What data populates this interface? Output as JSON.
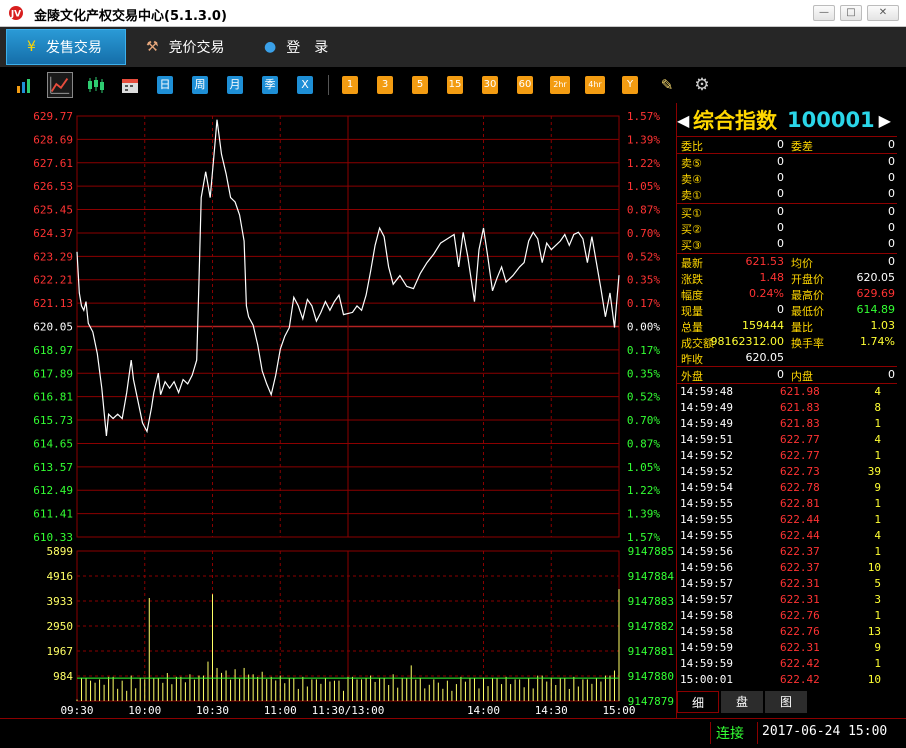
{
  "window": {
    "title": "金陵文化产权交易中心(5.1.3.0)",
    "min_glyph": "—",
    "max_glyph": "□",
    "close_glyph": "✕"
  },
  "tabs": [
    {
      "label": "发售交易",
      "icon": "yen-icon",
      "glyph": "¥",
      "active": true
    },
    {
      "label": "竞价交易",
      "icon": "gavel-icon",
      "glyph": "⚒",
      "active": false
    },
    {
      "label": "登　录",
      "icon": "user-icon",
      "glyph": "●",
      "active": false
    }
  ],
  "toolbar": {
    "view_icons": [
      {
        "name": "bar-chart-icon",
        "glyph": "▮"
      },
      {
        "name": "line-chart-icon",
        "glyph": "⟋"
      },
      {
        "name": "candlestick-icon",
        "glyph": "┃"
      },
      {
        "name": "calendar-icon",
        "glyph": "▦"
      }
    ],
    "period_buttons": [
      "日",
      "周",
      "月",
      "季",
      "X"
    ],
    "minute_buttons": [
      "1",
      "3",
      "5",
      "15",
      "30",
      "60",
      "2hr",
      "4hr",
      "Y"
    ],
    "tool_icons": [
      {
        "name": "draw-icon",
        "glyph": "✎"
      },
      {
        "name": "settings-gear-icon",
        "glyph": "⚙"
      }
    ]
  },
  "chart_data": {
    "type": "line",
    "title": "",
    "price_axis": [
      "629.77",
      "628.69",
      "627.61",
      "626.53",
      "625.45",
      "624.37",
      "623.29",
      "622.21",
      "621.13",
      "620.05",
      "618.97",
      "617.89",
      "616.81",
      "615.73",
      "614.65",
      "613.57",
      "612.49",
      "611.41",
      "610.33"
    ],
    "pct_axis": [
      "1.57%",
      "1.39%",
      "1.22%",
      "1.05%",
      "0.87%",
      "0.70%",
      "0.52%",
      "0.35%",
      "0.17%",
      "0.00%",
      "0.17%",
      "0.35%",
      "0.52%",
      "0.70%",
      "0.87%",
      "1.05%",
      "1.22%",
      "1.39%",
      "1.57%"
    ],
    "price_ylim": [
      610.33,
      629.77
    ],
    "prev_close": 620.05,
    "volume_axis": [
      "5899",
      "4916",
      "3933",
      "2950",
      "1967",
      "984"
    ],
    "amount_axis": [
      "9147885",
      "9147884",
      "9147883",
      "9147882",
      "9147881",
      "9147880",
      "9147879"
    ],
    "volume_ylim": [
      0,
      5899
    ],
    "time_labels": [
      "09:30",
      "10:00",
      "10:30",
      "11:00",
      "11:30/13:00",
      "14:00",
      "14:30",
      "15:00"
    ],
    "x_range": [
      "09:30",
      "15:00"
    ],
    "price_series": [
      [
        "09:30",
        623.5
      ],
      [
        "09:31",
        621.6
      ],
      [
        "09:32",
        621.0
      ],
      [
        "09:33",
        620.8
      ],
      [
        "09:34",
        621.2
      ],
      [
        "09:35",
        620.2
      ],
      [
        "09:37",
        619.8
      ],
      [
        "09:39",
        618.8
      ],
      [
        "09:41",
        617.2
      ],
      [
        "09:43",
        615.0
      ],
      [
        "09:44",
        616.0
      ],
      [
        "09:46",
        615.8
      ],
      [
        "09:48",
        616.0
      ],
      [
        "09:50",
        615.8
      ],
      [
        "09:52",
        617.0
      ],
      [
        "09:54",
        618.5
      ],
      [
        "09:55",
        617.6
      ],
      [
        "09:57",
        616.6
      ],
      [
        "09:59",
        615.6
      ],
      [
        "10:01",
        615.2
      ],
      [
        "10:03",
        616.3
      ],
      [
        "10:04",
        617.0
      ],
      [
        "10:06",
        617.9
      ],
      [
        "10:07",
        616.9
      ],
      [
        "10:09",
        617.5
      ],
      [
        "10:11",
        617.2
      ],
      [
        "10:13",
        617.5
      ],
      [
        "10:15",
        617.0
      ],
      [
        "10:17",
        617.6
      ],
      [
        "10:19",
        617.4
      ],
      [
        "10:21",
        617.8
      ],
      [
        "10:23",
        618.5
      ],
      [
        "10:24",
        622.0
      ],
      [
        "10:25",
        626.0
      ],
      [
        "10:27",
        627.2
      ],
      [
        "10:29",
        626.0
      ],
      [
        "10:31",
        628.4
      ],
      [
        "10:32",
        629.6
      ],
      [
        "10:34",
        628.0
      ],
      [
        "10:36",
        627.1
      ],
      [
        "10:38",
        626.0
      ],
      [
        "10:40",
        625.8
      ],
      [
        "10:42",
        625.2
      ],
      [
        "10:44",
        624.0
      ],
      [
        "10:45",
        621.0
      ],
      [
        "10:46",
        620.5
      ],
      [
        "10:48",
        620.1
      ],
      [
        "10:50",
        619.2
      ],
      [
        "10:52",
        618.0
      ],
      [
        "10:54",
        617.4
      ],
      [
        "10:56",
        616.9
      ],
      [
        "10:58",
        617.8
      ],
      [
        "11:00",
        619.0
      ],
      [
        "11:02",
        619.6
      ],
      [
        "11:04",
        620.0
      ],
      [
        "11:06",
        621.4
      ],
      [
        "11:08",
        621.0
      ],
      [
        "11:10",
        620.4
      ],
      [
        "11:12",
        621.3
      ],
      [
        "11:14",
        621.0
      ],
      [
        "11:16",
        620.3
      ],
      [
        "11:18",
        620.7
      ],
      [
        "11:20",
        621.2
      ],
      [
        "11:22",
        620.8
      ],
      [
        "11:24",
        621.2
      ],
      [
        "11:26",
        621.5
      ],
      [
        "11:28",
        620.6
      ],
      [
        "13:02",
        620.7
      ],
      [
        "13:04",
        621.0
      ],
      [
        "13:06",
        620.8
      ],
      [
        "13:08",
        621.5
      ],
      [
        "13:10",
        622.6
      ],
      [
        "13:12",
        623.8
      ],
      [
        "13:14",
        624.6
      ],
      [
        "13:16",
        624.2
      ],
      [
        "13:18",
        622.8
      ],
      [
        "13:20",
        622.0
      ],
      [
        "13:23",
        622.4
      ],
      [
        "13:26",
        621.9
      ],
      [
        "13:29",
        621.8
      ],
      [
        "13:32",
        622.5
      ],
      [
        "13:35",
        623.0
      ],
      [
        "13:38",
        623.4
      ],
      [
        "13:41",
        623.9
      ],
      [
        "13:44",
        624.1
      ],
      [
        "13:47",
        624.3
      ],
      [
        "13:49",
        622.8
      ],
      [
        "13:51",
        624.4
      ],
      [
        "13:53",
        623.3
      ],
      [
        "13:56",
        621.2
      ],
      [
        "13:58",
        623.6
      ],
      [
        "14:00",
        624.6
      ],
      [
        "14:02",
        623.2
      ],
      [
        "14:04",
        621.7
      ],
      [
        "14:06",
        622.3
      ],
      [
        "14:08",
        622.8
      ],
      [
        "14:10",
        622.1
      ],
      [
        "14:13",
        622.4
      ],
      [
        "14:16",
        622.8
      ],
      [
        "14:18",
        623.0
      ],
      [
        "14:20",
        624.0
      ],
      [
        "14:22",
        624.4
      ],
      [
        "14:24",
        624.1
      ],
      [
        "14:26",
        623.0
      ],
      [
        "14:28",
        623.9
      ],
      [
        "14:30",
        623.6
      ],
      [
        "14:32",
        623.8
      ],
      [
        "14:34",
        624.0
      ],
      [
        "14:36",
        624.3
      ],
      [
        "14:38",
        623.8
      ],
      [
        "14:40",
        624.3
      ],
      [
        "14:42",
        624.4
      ],
      [
        "14:44",
        624.1
      ],
      [
        "14:46",
        623.0
      ],
      [
        "14:48",
        624.2
      ],
      [
        "14:50",
        623.0
      ],
      [
        "14:52",
        621.8
      ],
      [
        "14:54",
        620.5
      ],
      [
        "14:56",
        621.6
      ],
      [
        "14:58",
        620.0
      ],
      [
        "15:00",
        622.42
      ]
    ],
    "volume_series": [
      [
        "09:30",
        60
      ],
      [
        "09:33",
        900
      ],
      [
        "09:36",
        800
      ],
      [
        "09:40",
        850
      ],
      [
        "09:45",
        950
      ],
      [
        "09:50",
        800
      ],
      [
        "09:54",
        1000
      ],
      [
        "09:58",
        900
      ],
      [
        "10:01",
        850
      ],
      [
        "10:02",
        4050
      ],
      [
        "10:05",
        900
      ],
      [
        "10:10",
        1100
      ],
      [
        "10:15",
        950
      ],
      [
        "10:20",
        1050
      ],
      [
        "10:25",
        1000
      ],
      [
        "10:29",
        1550
      ],
      [
        "10:30",
        4200
      ],
      [
        "10:32",
        1300
      ],
      [
        "10:36",
        1200
      ],
      [
        "10:40",
        1250
      ],
      [
        "10:44",
        1300
      ],
      [
        "10:48",
        1050
      ],
      [
        "10:52",
        1150
      ],
      [
        "10:56",
        950
      ],
      [
        "11:00",
        1000
      ],
      [
        "11:05",
        900
      ],
      [
        "11:10",
        950
      ],
      [
        "11:15",
        850
      ],
      [
        "11:20",
        900
      ],
      [
        "11:25",
        800
      ],
      [
        "13:01",
        950
      ],
      [
        "13:05",
        850
      ],
      [
        "13:10",
        1000
      ],
      [
        "13:15",
        900
      ],
      [
        "13:20",
        1050
      ],
      [
        "13:25",
        900
      ],
      [
        "13:28",
        1400
      ],
      [
        "13:32",
        900
      ],
      [
        "13:38",
        850
      ],
      [
        "13:44",
        800
      ],
      [
        "13:50",
        950
      ],
      [
        "13:55",
        900
      ],
      [
        "14:00",
        900
      ],
      [
        "14:05",
        900
      ],
      [
        "14:10",
        950
      ],
      [
        "14:15",
        850
      ],
      [
        "14:20",
        900
      ],
      [
        "14:25",
        1000
      ],
      [
        "14:30",
        900
      ],
      [
        "14:35",
        900
      ],
      [
        "14:40",
        950
      ],
      [
        "14:45",
        850
      ],
      [
        "14:50",
        900
      ],
      [
        "14:55",
        1000
      ],
      [
        "14:58",
        1200
      ],
      [
        "14:59",
        5200
      ],
      [
        "15:00",
        4400
      ]
    ]
  },
  "quote_panel": {
    "name": "综合指数",
    "code": "100001",
    "arrow_left": "◀",
    "arrow_right": "▶",
    "weibi_label": "委比",
    "weibi_value": "0",
    "weicha_label": "委差",
    "weicha_value": "0",
    "asks": [
      {
        "label": "卖⑤",
        "price": "0",
        "qty": "0"
      },
      {
        "label": "卖④",
        "price": "0",
        "qty": "0"
      },
      {
        "label": "卖①",
        "price": "0",
        "qty": "0"
      }
    ],
    "bids": [
      {
        "label": "买①",
        "price": "0",
        "qty": "0"
      },
      {
        "label": "买②",
        "price": "0",
        "qty": "0"
      },
      {
        "label": "买③",
        "price": "0",
        "qty": "0"
      }
    ],
    "stats": [
      {
        "l1": "最新",
        "v1": "621.53",
        "c1": "r",
        "l2": "均价",
        "v2": "0",
        "c2": "w"
      },
      {
        "l1": "涨跌",
        "v1": "1.48",
        "c1": "r",
        "l2": "开盘价",
        "v2": "620.05",
        "c2": "w"
      },
      {
        "l1": "幅度",
        "v1": "0.24%",
        "c1": "r",
        "l2": "最高价",
        "v2": "629.69",
        "c2": "r"
      },
      {
        "l1": "现量",
        "v1": "0",
        "c1": "w",
        "l2": "最低价",
        "v2": "614.89",
        "c2": "g"
      },
      {
        "l1": "总量",
        "v1": "159444",
        "c1": "y",
        "l2": "量比",
        "v2": "1.03",
        "c2": "y"
      },
      {
        "l1": "成交额",
        "v1": "98162312.00",
        "c1": "y",
        "l2": "换手率",
        "v2": "1.74%",
        "c2": "y"
      },
      {
        "l1": "昨收",
        "v1": "620.05",
        "c1": "w",
        "l2": "",
        "v2": "",
        "c2": "w"
      }
    ],
    "outer_label": "外盘",
    "outer_value": "0",
    "inner_label": "内盘",
    "inner_value": "0",
    "ticks": [
      {
        "time": "14:59:48",
        "price": "621.98",
        "vol": "4"
      },
      {
        "time": "14:59:49",
        "price": "621.83",
        "vol": "8"
      },
      {
        "time": "14:59:49",
        "price": "621.83",
        "vol": "1"
      },
      {
        "time": "14:59:51",
        "price": "622.77",
        "vol": "4"
      },
      {
        "time": "14:59:52",
        "price": "622.77",
        "vol": "1"
      },
      {
        "time": "14:59:52",
        "price": "622.73",
        "vol": "39"
      },
      {
        "time": "14:59:54",
        "price": "622.78",
        "vol": "9"
      },
      {
        "time": "14:59:55",
        "price": "622.81",
        "vol": "1"
      },
      {
        "time": "14:59:55",
        "price": "622.44",
        "vol": "1"
      },
      {
        "time": "14:59:55",
        "price": "622.44",
        "vol": "4"
      },
      {
        "time": "14:59:56",
        "price": "622.37",
        "vol": "1"
      },
      {
        "time": "14:59:56",
        "price": "622.37",
        "vol": "10"
      },
      {
        "time": "14:59:57",
        "price": "622.31",
        "vol": "5"
      },
      {
        "time": "14:59:57",
        "price": "622.31",
        "vol": "3"
      },
      {
        "time": "14:59:58",
        "price": "622.76",
        "vol": "1"
      },
      {
        "time": "14:59:58",
        "price": "622.76",
        "vol": "13"
      },
      {
        "time": "14:59:59",
        "price": "622.31",
        "vol": "9"
      },
      {
        "time": "14:59:59",
        "price": "622.42",
        "vol": "1"
      },
      {
        "time": "15:00:01",
        "price": "622.42",
        "vol": "10"
      }
    ],
    "tabs": [
      "细",
      "盘",
      "图"
    ]
  },
  "status": {
    "connection": "连接",
    "datetime": "2017-06-24 15:00"
  },
  "colors": {
    "grid": "#8b0000",
    "up": "#ff3333",
    "down": "#33ff33",
    "label": "#ffd700",
    "line": "#ffffff"
  }
}
